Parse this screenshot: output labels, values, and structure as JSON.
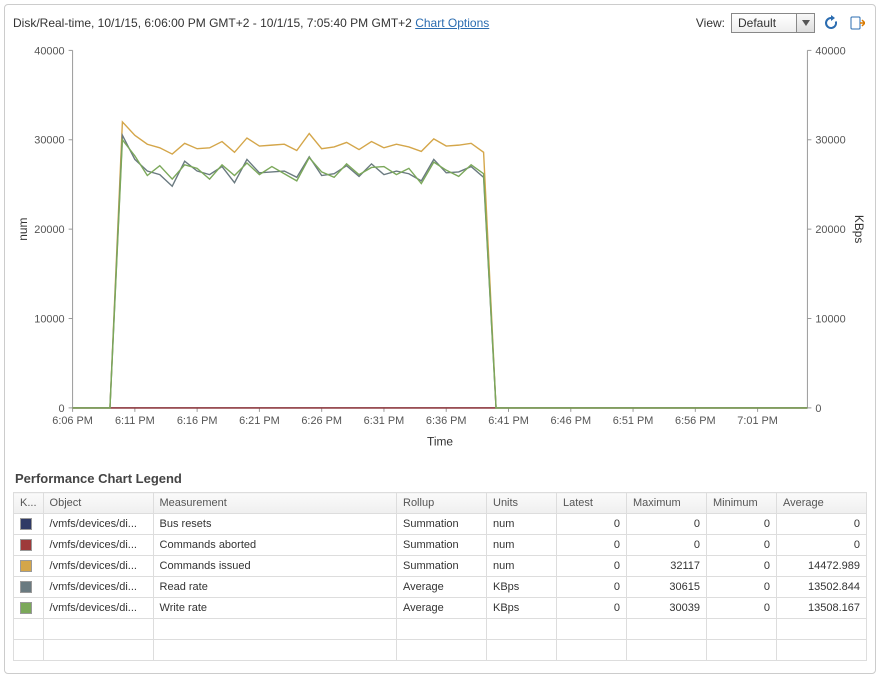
{
  "header": {
    "title_prefix": "Disk/Real-time, 10/1/15, 6:06:00 PM GMT+2 - 10/1/15, 7:05:40 PM GMT+2",
    "chart_options_label": "Chart Options",
    "view_label": "View:",
    "view_selected": "Default"
  },
  "icons": {
    "refresh": "refresh-icon",
    "export": "export-icon",
    "dropdown": "chevron-down-icon"
  },
  "chart_axes": {
    "left_label": "num",
    "right_label": "KBps",
    "x_label": "Time",
    "y_ticks": [
      0,
      10000,
      20000,
      30000,
      40000
    ],
    "x_ticks": [
      "6:06 PM",
      "6:11 PM",
      "6:16 PM",
      "6:21 PM",
      "6:26 PM",
      "6:31 PM",
      "6:36 PM",
      "6:41 PM",
      "6:46 PM",
      "6:51 PM",
      "6:56 PM",
      "7:01 PM"
    ]
  },
  "legend": {
    "title": "Performance Chart Legend",
    "columns": [
      "K...",
      "Object",
      "Measurement",
      "Rollup",
      "Units",
      "Latest",
      "Maximum",
      "Minimum",
      "Average"
    ],
    "rows": [
      {
        "color": "#2f3a66",
        "object": "/vmfs/devices/di...",
        "measurement": "Bus resets",
        "rollup": "Summation",
        "units": "num",
        "latest": "0",
        "maximum": "0",
        "minimum": "0",
        "average": "0"
      },
      {
        "color": "#9e3a3a",
        "object": "/vmfs/devices/di...",
        "measurement": "Commands aborted",
        "rollup": "Summation",
        "units": "num",
        "latest": "0",
        "maximum": "0",
        "minimum": "0",
        "average": "0"
      },
      {
        "color": "#d4a64a",
        "object": "/vmfs/devices/di...",
        "measurement": "Commands issued",
        "rollup": "Summation",
        "units": "num",
        "latest": "0",
        "maximum": "32117",
        "minimum": "0",
        "average": "14472.989"
      },
      {
        "color": "#6a7a80",
        "object": "/vmfs/devices/di...",
        "measurement": "Read rate",
        "rollup": "Average",
        "units": "KBps",
        "latest": "0",
        "maximum": "30615",
        "minimum": "0",
        "average": "13502.844"
      },
      {
        "color": "#7ba85a",
        "object": "/vmfs/devices/di...",
        "measurement": "Write rate",
        "rollup": "Average",
        "units": "KBps",
        "latest": "0",
        "maximum": "30039",
        "minimum": "0",
        "average": "13508.167"
      }
    ]
  },
  "chart_data": {
    "type": "line",
    "title": "Disk/Real-time",
    "xlabel": "Time",
    "ylabel_left": "num",
    "ylabel_right": "KBps",
    "ylim": [
      0,
      40000
    ],
    "x": [
      "6:06",
      "6:07",
      "6:08",
      "6:09",
      "6:10",
      "6:11",
      "6:12",
      "6:13",
      "6:14",
      "6:15",
      "6:16",
      "6:17",
      "6:18",
      "6:19",
      "6:20",
      "6:21",
      "6:22",
      "6:23",
      "6:24",
      "6:25",
      "6:26",
      "6:27",
      "6:28",
      "6:29",
      "6:30",
      "6:31",
      "6:32",
      "6:33",
      "6:34",
      "6:35",
      "6:36",
      "6:37",
      "6:38",
      "6:39",
      "6:40",
      "6:41",
      "6:42",
      "6:43",
      "6:44",
      "6:45",
      "6:46",
      "6:47",
      "6:48",
      "6:49",
      "6:50",
      "6:51",
      "6:52",
      "6:53",
      "6:54",
      "6:55",
      "6:56",
      "6:57",
      "6:58",
      "6:59",
      "7:00",
      "7:01",
      "7:02",
      "7:03",
      "7:04",
      "7:05"
    ],
    "series": [
      {
        "name": "Bus resets",
        "axis": "left",
        "color": "#2f3a66",
        "values": [
          0,
          0,
          0,
          0,
          0,
          0,
          0,
          0,
          0,
          0,
          0,
          0,
          0,
          0,
          0,
          0,
          0,
          0,
          0,
          0,
          0,
          0,
          0,
          0,
          0,
          0,
          0,
          0,
          0,
          0,
          0,
          0,
          0,
          0,
          0,
          0,
          0,
          0,
          0,
          0,
          0,
          0,
          0,
          0,
          0,
          0,
          0,
          0,
          0,
          0,
          0,
          0,
          0,
          0,
          0,
          0,
          0,
          0,
          0,
          0
        ]
      },
      {
        "name": "Commands aborted",
        "axis": "left",
        "color": "#9e3a3a",
        "values": [
          0,
          0,
          0,
          0,
          0,
          0,
          0,
          0,
          0,
          0,
          0,
          0,
          0,
          0,
          0,
          0,
          0,
          0,
          0,
          0,
          0,
          0,
          0,
          0,
          0,
          0,
          0,
          0,
          0,
          0,
          0,
          0,
          0,
          0,
          0,
          0,
          0,
          0,
          0,
          0,
          0,
          0,
          0,
          0,
          0,
          0,
          0,
          0,
          0,
          0,
          0,
          0,
          0,
          0,
          0,
          0,
          0,
          0,
          0,
          0
        ]
      },
      {
        "name": "Commands issued",
        "axis": "left",
        "color": "#d4a64a",
        "values": [
          0,
          0,
          0,
          0,
          32000,
          30500,
          29500,
          29100,
          28400,
          29600,
          29000,
          29100,
          29800,
          28600,
          30200,
          29300,
          29400,
          29500,
          28800,
          30700,
          29000,
          29200,
          29700,
          28900,
          29800,
          29100,
          29500,
          29200,
          28700,
          30100,
          29300,
          29400,
          29600,
          28600,
          0,
          0,
          0,
          0,
          0,
          0,
          0,
          0,
          0,
          0,
          0,
          0,
          0,
          0,
          0,
          0,
          0,
          0,
          0,
          0,
          0,
          0,
          0,
          0,
          0,
          0
        ]
      },
      {
        "name": "Read rate",
        "axis": "right",
        "color": "#6a7a80",
        "values": [
          0,
          0,
          0,
          0,
          30500,
          27800,
          26500,
          26100,
          24800,
          27600,
          26500,
          26100,
          27000,
          25200,
          27800,
          26300,
          26400,
          26500,
          25800,
          28100,
          26000,
          26200,
          27100,
          25900,
          27300,
          26100,
          26500,
          26200,
          25400,
          27800,
          26300,
          26400,
          27000,
          25800,
          0,
          0,
          0,
          0,
          0,
          0,
          0,
          0,
          0,
          0,
          0,
          0,
          0,
          0,
          0,
          0,
          0,
          0,
          0,
          0,
          0,
          0,
          0,
          0,
          0,
          0
        ]
      },
      {
        "name": "Write rate",
        "axis": "right",
        "color": "#7ba85a",
        "values": [
          0,
          0,
          0,
          0,
          30000,
          28200,
          26000,
          27100,
          25600,
          27200,
          26800,
          25600,
          27200,
          26000,
          27400,
          26100,
          27000,
          26200,
          25400,
          28000,
          26400,
          25800,
          27300,
          26100,
          26900,
          27000,
          26100,
          26800,
          25100,
          27500,
          26600,
          25900,
          27200,
          26200,
          0,
          0,
          0,
          0,
          0,
          0,
          0,
          0,
          0,
          0,
          0,
          0,
          0,
          0,
          0,
          0,
          0,
          0,
          0,
          0,
          0,
          0,
          0,
          0,
          0,
          0
        ]
      }
    ]
  }
}
